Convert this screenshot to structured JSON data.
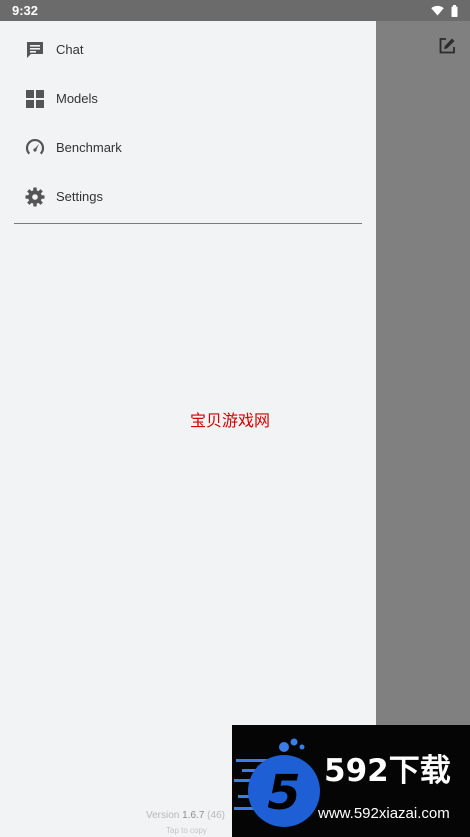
{
  "status_bar": {
    "time": "9:32",
    "icons": [
      "wifi-icon",
      "battery-icon"
    ]
  },
  "drawer": {
    "items": [
      {
        "label": "Chat",
        "icon": "chat-icon"
      },
      {
        "label": "Models",
        "icon": "grid-icon"
      },
      {
        "label": "Benchmark",
        "icon": "speedometer-icon"
      },
      {
        "label": "Settings",
        "icon": "gear-icon"
      }
    ],
    "watermark": "宝贝游戏网",
    "version": {
      "prefix": "Version",
      "number": "1.6.7",
      "build": "(46)",
      "hint": "Tap to copy"
    }
  },
  "toolbar": {
    "new_chat_icon": "edit-icon"
  },
  "banner": {
    "logo_digit": "5",
    "title": "592下载",
    "url": "www.592xiazai.com"
  },
  "colors": {
    "drawer_bg": "#f2f3f5",
    "scrim": "#808080",
    "status_bar": "#6b6b6b",
    "icon": "#555555",
    "watermark": "#d40000",
    "banner_blue": "#1e5fd6"
  }
}
